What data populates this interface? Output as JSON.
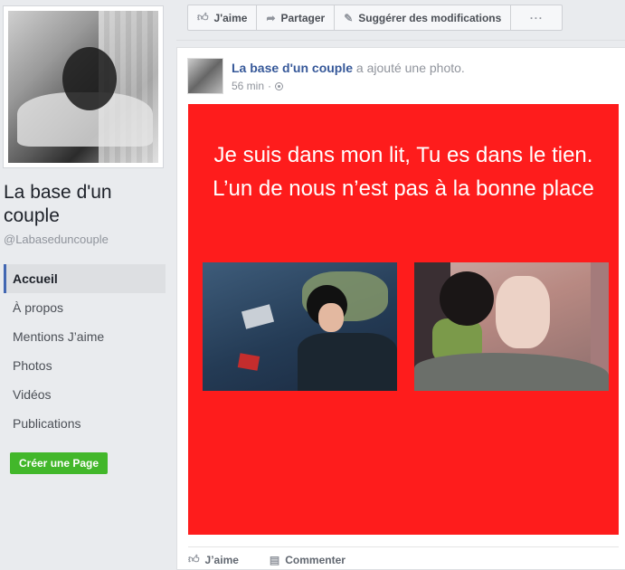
{
  "sidebar": {
    "page_name": "La base d'un couple",
    "handle": "@Labaseduncouple",
    "nav": [
      {
        "label": "Accueil",
        "active": true
      },
      {
        "label": "À propos"
      },
      {
        "label": "Mentions J’aime"
      },
      {
        "label": "Photos"
      },
      {
        "label": "Vidéos"
      },
      {
        "label": "Publications"
      }
    ],
    "create_page_label": "Créer une Page"
  },
  "action_bar": {
    "like_label": "J'aime",
    "share_label": "Partager",
    "suggest_label": "Suggérer des modifications",
    "more_label": "···"
  },
  "post": {
    "author": "La base d'un couple",
    "action_text": "a ajouté une photo.",
    "time": "56 min",
    "meta_sep": "·",
    "image_text": "Je suis dans mon lit, Tu es dans le tien. L’un de nous n’est pas à la bonne place",
    "image_bg": "#fe1c1c",
    "like_label": "J’aime",
    "comment_label": "Commenter"
  },
  "icons": {
    "like": "thumbs-up-icon",
    "share": "share-arrow-icon",
    "suggest": "pencil-icon",
    "comment": "comment-icon",
    "privacy": "globe-icon"
  },
  "colors": {
    "link": "#365899",
    "accent": "#4267b2",
    "create_button": "#42b72a"
  }
}
